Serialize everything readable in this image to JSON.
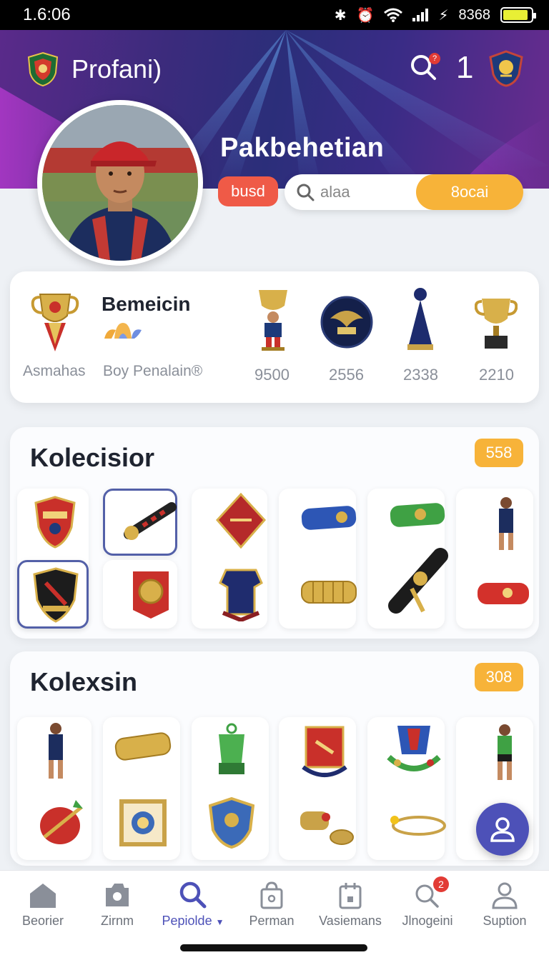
{
  "status_bar": {
    "time": "1.6:06",
    "battery_text": "8368",
    "battery_level": 0.9
  },
  "header": {
    "title": "Profani)",
    "notification_count": "?",
    "count": "1"
  },
  "profile": {
    "name": "Pakbehetian",
    "tag": "busd",
    "search": {
      "placeholder": "alaa",
      "button_label": "8ocai"
    }
  },
  "stats": {
    "highlight": {
      "title": "Bemeicin",
      "label_left": "Asmahas",
      "label_right": "Boy Penalain®"
    },
    "trophies": [
      {
        "icon": "player-figure-trophy-icon",
        "value": "9500"
      },
      {
        "icon": "eagle-medal-icon",
        "value": "2556"
      },
      {
        "icon": "blue-cone-trophy-icon",
        "value": "2338"
      },
      {
        "icon": "gold-cup-icon",
        "value": "2210"
      }
    ]
  },
  "collections": [
    {
      "title": "Kolecisior",
      "count": "558",
      "items": [
        "red-shield-crest-icon",
        "black-cannon-icon",
        "red-diamond-badge-icon",
        "blue-scarf-icon",
        "green-scarf-icon",
        "player-figure-icon",
        "black-shield-crest-icon",
        "gold-medal-banner-icon",
        "navy-shirt-icon",
        "gold-scarf-icon",
        "black-scroll-icon",
        "red-scarf-icon"
      ]
    },
    {
      "title": "Kolexsin",
      "count": "308",
      "items": [
        "player-figure-icon",
        "gold-scarf-icon",
        "green-lantern-cup-icon",
        "red-banner-icon",
        "flag-wreath-icon",
        "green-player-figure-icon",
        "red-ball-icon",
        "framed-medal-icon",
        "blue-police-badge-icon",
        "gold-coins-icon",
        "gold-bracelet-icon"
      ]
    }
  ],
  "bottom_nav": [
    {
      "label": "Beorier",
      "icon": "home-icon"
    },
    {
      "label": "Zirnm",
      "icon": "camera-icon"
    },
    {
      "label": "Pepiolde",
      "icon": "search-icon",
      "active": true
    },
    {
      "label": "Perman",
      "icon": "bag-icon"
    },
    {
      "label": "Vasiemans",
      "icon": "calendar-bag-icon"
    },
    {
      "label": "Jlnogeini",
      "icon": "search-notify-icon",
      "badge": "2"
    },
    {
      "label": "Suption",
      "icon": "person-icon"
    }
  ],
  "colors": {
    "accent": "#4d51b8",
    "badge_orange": "#f7b339",
    "tag_red": "#ef5a47",
    "header_purple": "#3b2b7c"
  }
}
